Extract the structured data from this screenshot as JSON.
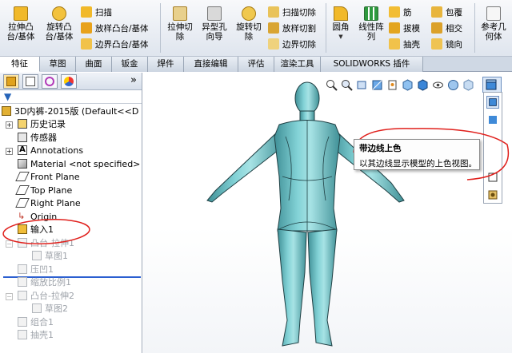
{
  "ribbon": {
    "extrude_boss": "拉伸凸\n台/基体",
    "revolve_boss": "旋转凸\n台/基体",
    "sweep": "扫描",
    "loft_boss": "放样凸台/基体",
    "boundary_boss": "边界凸台/基体",
    "extrude_cut": "拉伸切\n除",
    "hole_wizard": "异型孔\n向导",
    "revolve_cut": "旋转切\n除",
    "swept_cut": "扫描切除",
    "lofted_cut": "放样切割",
    "boundary_cut": "边界切除",
    "fillet": "圆角",
    "linear_pattern": "线性阵\n列",
    "rib": "筋",
    "draft": "拔模",
    "shell": "抽壳",
    "wrap": "包覆",
    "intersect": "相交",
    "mirror": "镜向",
    "reference_geometry": "参考几\n何体"
  },
  "tabs": [
    "特征",
    "草图",
    "曲面",
    "钣金",
    "焊件",
    "直接编辑",
    "评估",
    "渲染工具",
    "SOLIDWORKS 插件"
  ],
  "active_tab": 0,
  "tree": {
    "root": "3D内裤-2015版  (Default<<D",
    "items": [
      {
        "label": "历史记录",
        "grey": false
      },
      {
        "label": "传感器",
        "grey": false
      },
      {
        "label": "Annotations",
        "grey": false
      },
      {
        "label": "Material <not specified>",
        "grey": false
      },
      {
        "label": "Front Plane",
        "grey": false
      },
      {
        "label": "Top Plane",
        "grey": false
      },
      {
        "label": "Right Plane",
        "grey": false
      },
      {
        "label": "Origin",
        "grey": false
      },
      {
        "label": "输入1",
        "grey": false
      },
      {
        "label": "凸台-拉伸1",
        "grey": true
      },
      {
        "label": "草图1",
        "grey": true
      },
      {
        "label": "压凹1",
        "grey": true
      },
      {
        "label": "缩放比例1",
        "grey": true
      },
      {
        "label": "凸台-拉伸2",
        "grey": true
      },
      {
        "label": "草图2",
        "grey": true
      },
      {
        "label": "组合1",
        "grey": true
      },
      {
        "label": "抽壳1",
        "grey": true
      }
    ]
  },
  "tooltip": {
    "title": "带边线上色",
    "description": "以其边线显示模型的上色视图。"
  },
  "panel_collapse": "»",
  "colors": {
    "model": "#6fc7cc",
    "annotation_red": "#e0201c",
    "accent": "#2b5fd0"
  }
}
